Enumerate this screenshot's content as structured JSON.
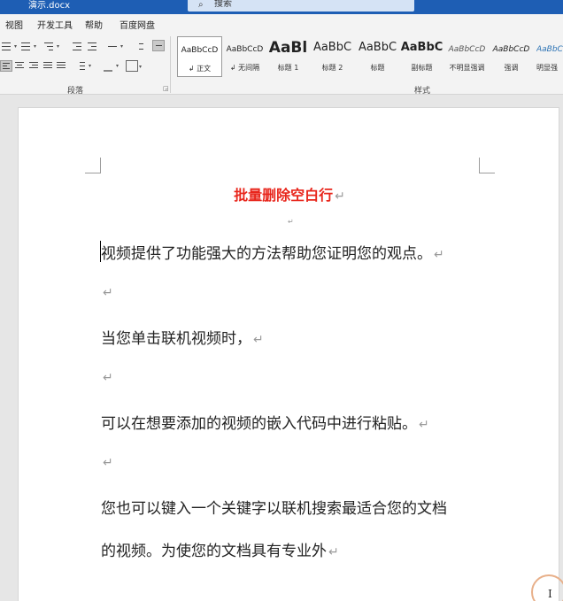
{
  "titlebar": {
    "doc_name": "演示.docx",
    "search_placeholder": "搜索",
    "search_icon": "search-icon"
  },
  "tabs": [
    "视图",
    "开发工具",
    "帮助",
    "百度网盘"
  ],
  "ribbon": {
    "paragraph_group_label": "段落",
    "styles_group_label": "样式",
    "styles": [
      {
        "sample": "AaBbCcD",
        "name": "↲ 正文"
      },
      {
        "sample": "AaBbCcD",
        "name": "↲ 无间隔"
      },
      {
        "sample": "AaBl",
        "name": "标题 1"
      },
      {
        "sample": "AaBbC",
        "name": "标题 2"
      },
      {
        "sample": "AaBbC",
        "name": "标题"
      },
      {
        "sample": "AaBbC",
        "name": "副标题"
      },
      {
        "sample": "AaBbCcD",
        "name": "不明显强调"
      },
      {
        "sample": "AaBbCcD",
        "name": "强调"
      },
      {
        "sample": "AaBbCcD",
        "name": "明显强"
      }
    ]
  },
  "document": {
    "paragraph_mark": "↵",
    "title": "批量删除空白行",
    "lines": [
      "视频提供了功能强大的方法帮助您证明您的观点。",
      "",
      "当您单击联机视频时，",
      "",
      "可以在想要添加的视频的嵌入代码中进行粘贴。",
      "",
      "您也可以键入一个关键字以联机搜索最适合您的文档",
      "的视频。为使您的文档具有专业外"
    ]
  },
  "cursor": {
    "glyph": "I"
  }
}
